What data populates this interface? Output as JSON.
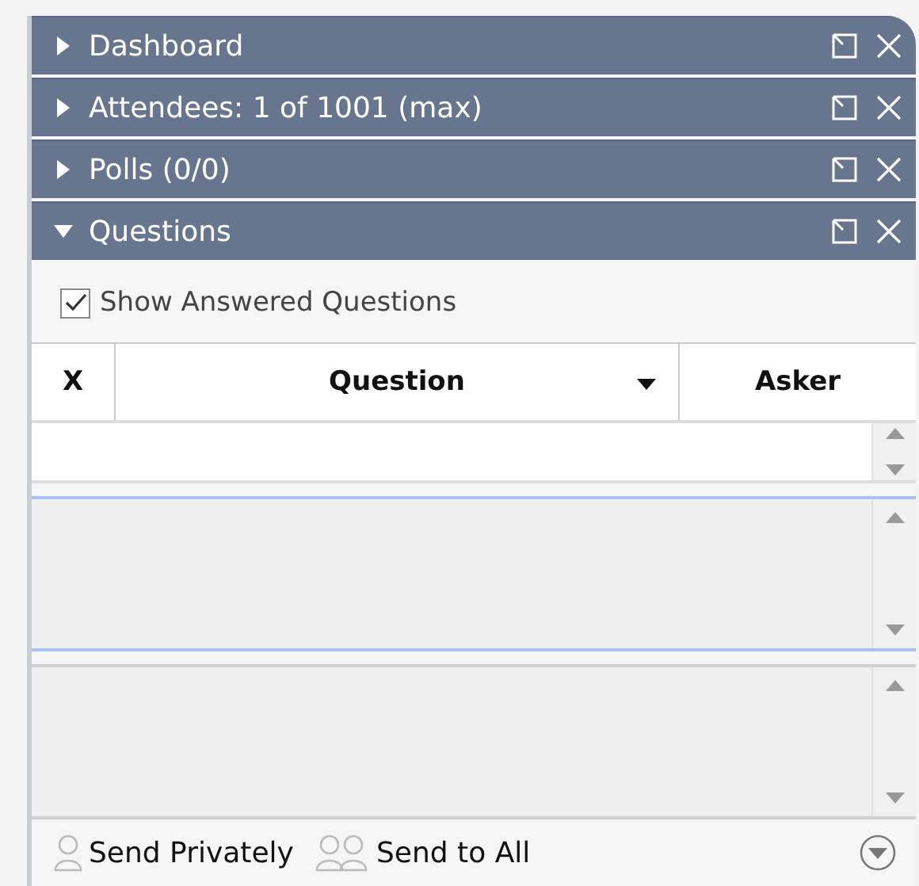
{
  "sections": [
    {
      "title": "Dashboard",
      "expanded": false
    },
    {
      "title": "Attendees: 1 of 1001 (max)",
      "expanded": false
    },
    {
      "title": "Polls (0/0)",
      "expanded": false
    },
    {
      "title": "Questions",
      "expanded": true
    }
  ],
  "show_answered": {
    "label": "Show Answered Questions",
    "checked": true
  },
  "table": {
    "columns": [
      "X",
      "Question",
      "Asker"
    ]
  },
  "footer": {
    "buttons": [
      {
        "label": "Send Privately",
        "kind": "single"
      },
      {
        "label": "Send to All",
        "kind": "group"
      }
    ]
  }
}
